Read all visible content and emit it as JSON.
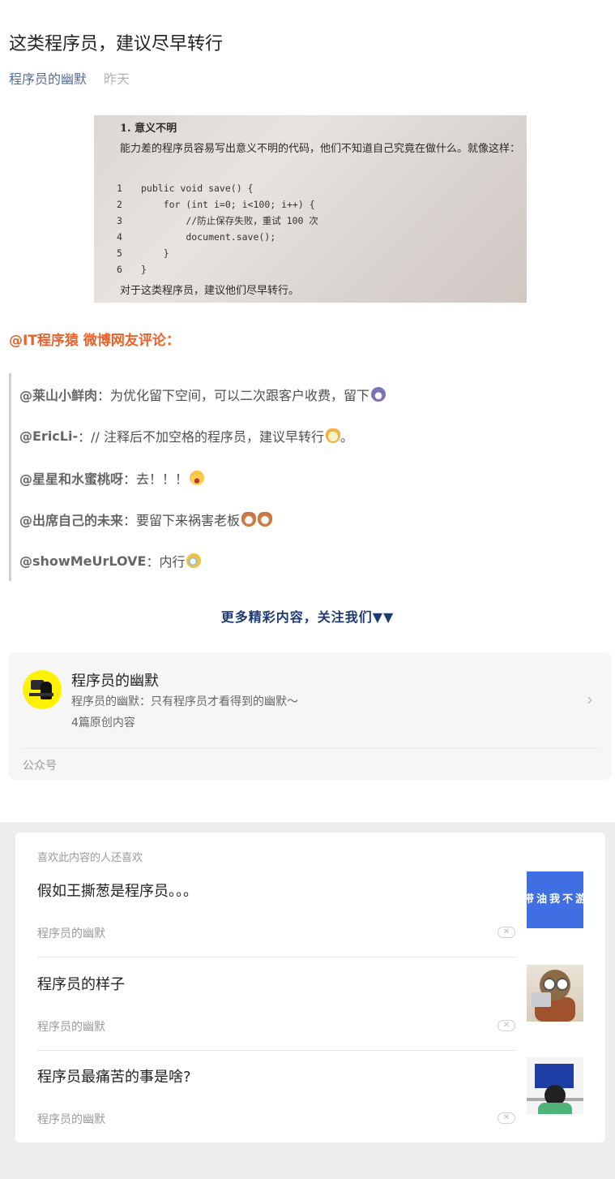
{
  "article": {
    "title": "这类程序员，建议尽早转行",
    "author": "程序员的幽默",
    "date": "昨天"
  },
  "photo": {
    "heading": "1. 意义不明",
    "intro": "能力差的程序员容易写出意义不明的代码，他们不知道自己究竟在做什么。就像这样：",
    "code_lines": [
      {
        "num": "1",
        "text": "public void save() {"
      },
      {
        "num": "2",
        "text": "    for (int i=0; i<100; i++) {"
      },
      {
        "num": "3",
        "text": "        //防止保存失败，重试 100 次"
      },
      {
        "num": "4",
        "text": "        document.save();"
      },
      {
        "num": "5",
        "text": "    }"
      },
      {
        "num": "6",
        "text": "}"
      }
    ],
    "footer": "对于这类程序员，建议他们尽早转行。"
  },
  "comments_header": "@IT程序猿 微博网友评论：",
  "comments": [
    {
      "user": "@莱山小鲜肉",
      "text": "：为优化留下空间，可以二次跟客户收费，留下",
      "emoji": "scared-face-icon"
    },
    {
      "user": "@EricLi-",
      "text": "：// 注释后不加空格的程序员，建议早转行",
      "emoji": "doge-icon",
      "trail": "。"
    },
    {
      "user": "@星星和水蜜桃呀",
      "text": "：去！！！",
      "emoji": "laughing-tears-icon"
    },
    {
      "user": "@出席自己的未来",
      "text": "：要留下来祸害老板",
      "emoji": "cat-face-icon"
    },
    {
      "user": "@showMeUrLOVE",
      "text": "：内行",
      "emoji": "laugh-cry-icon"
    }
  ],
  "more_link": "更多精彩内容，关注我们▼▼",
  "profile": {
    "name": "程序员的幽默",
    "description": "程序员的幽默：只有程序员才看得到的幽默～",
    "count": "4篇原创内容",
    "type": "公众号"
  },
  "recommend": {
    "heading": "喜欢此内容的人还喜欢",
    "items": [
      {
        "title": "假如王撕葱是程序员。。。",
        "source": "程序员的幽默",
        "thumb_text": "带油我不游"
      },
      {
        "title": "程序员的样子",
        "source": "程序员的幽默"
      },
      {
        "title": "程序员最痛苦的事是啥?",
        "source": "程序员的幽默"
      }
    ],
    "close_symbol": "✕"
  },
  "colors": {
    "link": "#576b95",
    "accent_orange": "#e8632b",
    "more_link": "#1f3a70",
    "thumb_blue": "#3f6fe3"
  }
}
